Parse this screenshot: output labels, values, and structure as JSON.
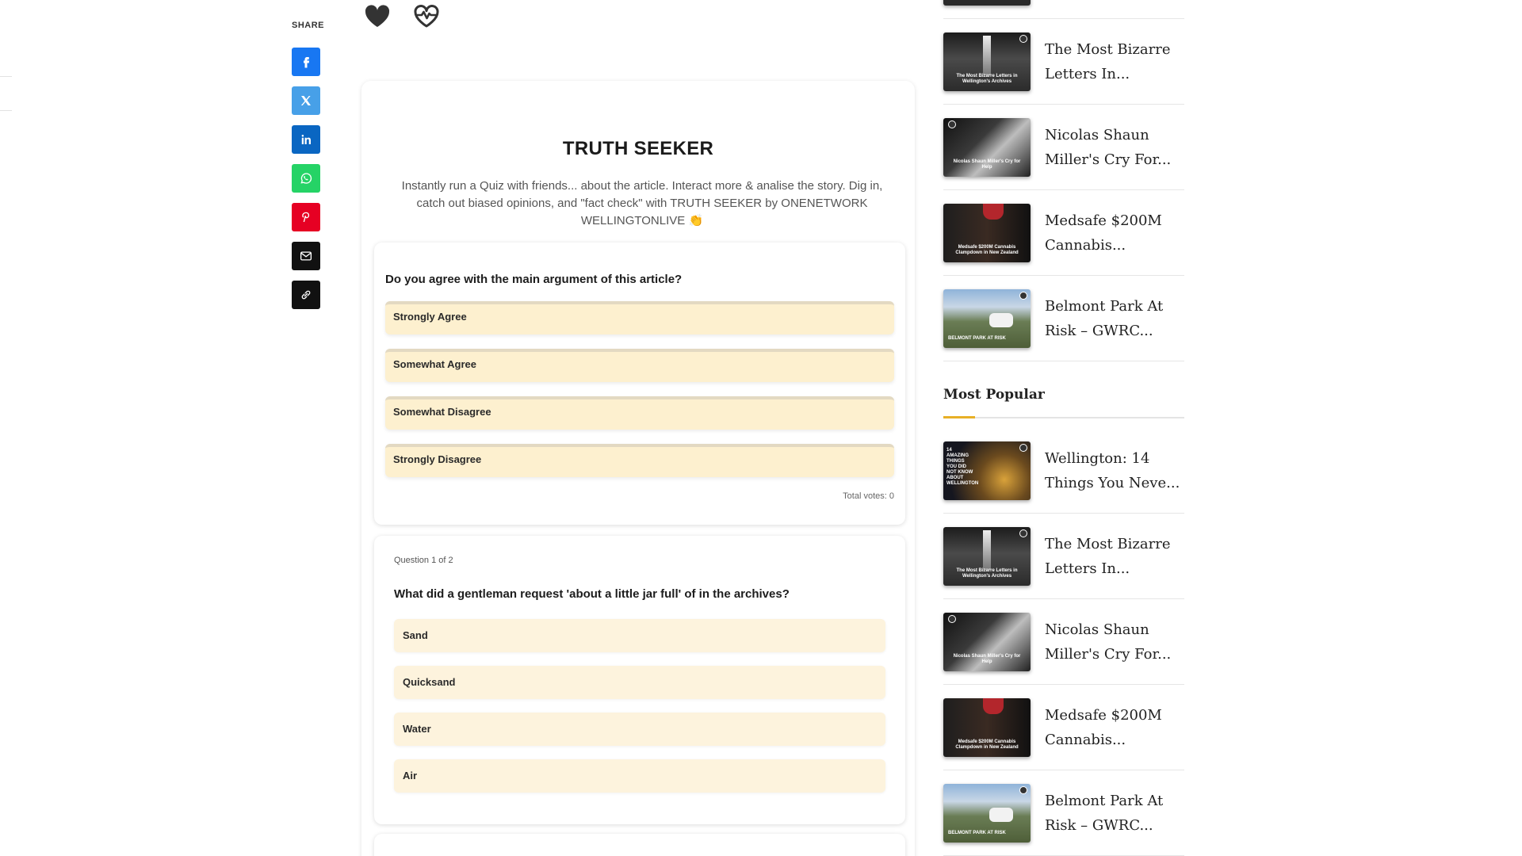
{
  "share": {
    "label": "SHARE",
    "buttons": [
      {
        "name": "facebook",
        "color": "#1877f2",
        "icon": "facebook-icon"
      },
      {
        "name": "x",
        "color": "#47a0e8",
        "icon": "x-icon"
      },
      {
        "name": "linkedin",
        "color": "#0a66c2",
        "icon": "linkedin-icon"
      },
      {
        "name": "whatsapp",
        "color": "#25d366",
        "icon": "whatsapp-icon"
      },
      {
        "name": "pinterest",
        "color": "#e60023",
        "icon": "pinterest-icon"
      },
      {
        "name": "email",
        "color": "#111111",
        "icon": "mail-icon"
      },
      {
        "name": "copy-link",
        "color": "#111111",
        "icon": "link-icon"
      }
    ]
  },
  "reactions": [
    "heart-icon",
    "heartbeat-icon"
  ],
  "quiz": {
    "title": "TRUTH SEEKER",
    "description": "Instantly run a Quiz with friends... about the article. Interact more & analise the story. Dig in, catch out biased opinions, and \"fact check\" with TRUTH SEEKER by ONENETWORK WELLINGTONLIVE 👏"
  },
  "poll": {
    "question": "Do you agree with the main argument of this article?",
    "options": [
      "Strongly Agree",
      "Somewhat Agree",
      "Somewhat Disagree",
      "Strongly Disagree"
    ],
    "total_votes": "Total votes: 0"
  },
  "trivia": {
    "counter": "Question 1 of 2",
    "question": "What did a gentleman request 'about a little jar full' of in the archives?",
    "options": [
      "Sand",
      "Quicksand",
      "Water",
      "Air"
    ]
  },
  "sidebar": {
    "top_items": [
      {
        "title_l1": "The Most Bizarre",
        "title_l2": "Letters In...",
        "thumb": "archives"
      },
      {
        "title_l1": "Nicolas Shaun",
        "title_l2": "Miller's Cry For...",
        "thumb": "nicolas"
      },
      {
        "title_l1": "Medsafe $200M",
        "title_l2": "Cannabis...",
        "thumb": "medsafe"
      },
      {
        "title_l1": "Belmont Park At",
        "title_l2": "Risk – GWRC...",
        "thumb": "belmont"
      }
    ],
    "section_title": "Most Popular",
    "popular_items": [
      {
        "title_l1": "Wellington: 14",
        "title_l2": "Things You Neve...",
        "thumb": "wellington"
      },
      {
        "title_l1": "The Most Bizarre",
        "title_l2": "Letters In...",
        "thumb": "archives"
      },
      {
        "title_l1": "Nicolas Shaun",
        "title_l2": "Miller's Cry For...",
        "thumb": "nicolas"
      },
      {
        "title_l1": "Medsafe $200M",
        "title_l2": "Cannabis...",
        "thumb": "medsafe"
      },
      {
        "title_l1": "Belmont Park At",
        "title_l2": "Risk – GWRC...",
        "thumb": "belmont"
      }
    ],
    "thumb_text": {
      "archives": "The Most Bizarre Letters in Wellington's Archives",
      "nicolas": "Nicolas Shaun Miller's Cry for Help",
      "medsafe": "Medsafe $200M Cannabis Clampdown in New Zealand",
      "belmont": "BELMONT PARK AT RISK",
      "wellington": "14 AMAZING THINGS YOU DID NOT KNOW ABOUT WELLINGTON"
    }
  },
  "colors": {
    "poll_option_bg": "#fdf0cf",
    "trivia_option_bg": "#fdf3dd",
    "accent": "#e8b026"
  }
}
